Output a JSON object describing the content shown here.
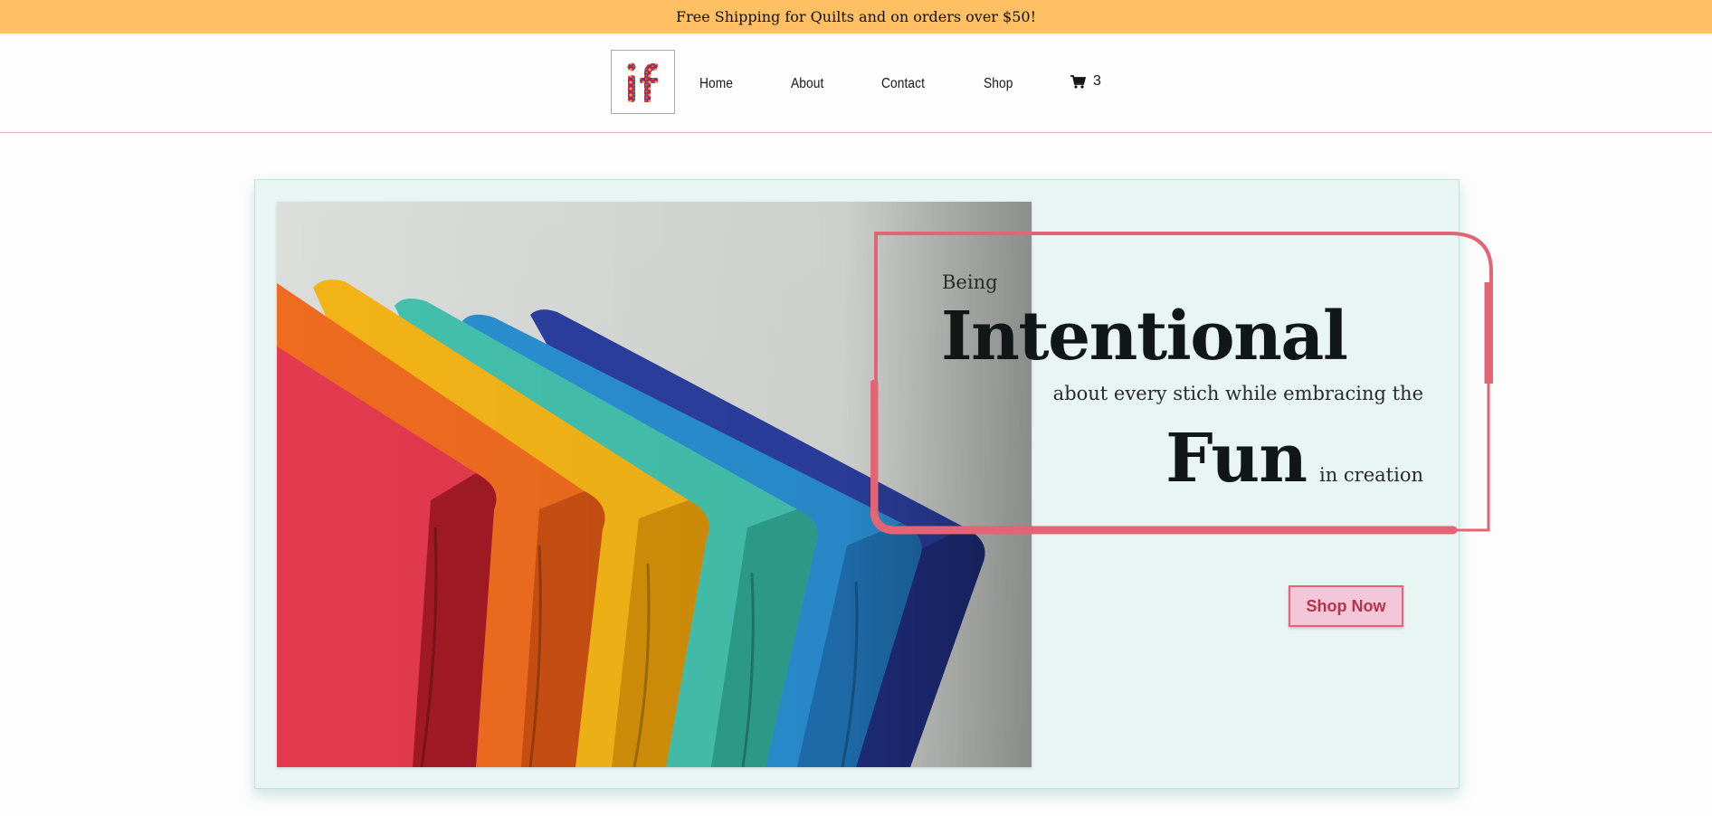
{
  "promo": {
    "text": "Free Shipping for Quilts and on orders over $50!"
  },
  "header": {
    "logo_alt": "if",
    "nav": [
      {
        "label": "Home"
      },
      {
        "label": "About"
      },
      {
        "label": "Contact"
      },
      {
        "label": "Shop"
      }
    ],
    "cart": {
      "icon": "cart-icon",
      "count": "3"
    }
  },
  "hero": {
    "being": "Being",
    "intentional": "Intentional",
    "about": "about every stich while embracing the",
    "fun": "Fun",
    "creation": "in creation",
    "cta": "Shop Now"
  },
  "colors": {
    "promo_bg": "#ffbf63",
    "hero_bg": "#e8f5f2",
    "accent": "#e26575",
    "button_bg": "#f3c6da"
  }
}
